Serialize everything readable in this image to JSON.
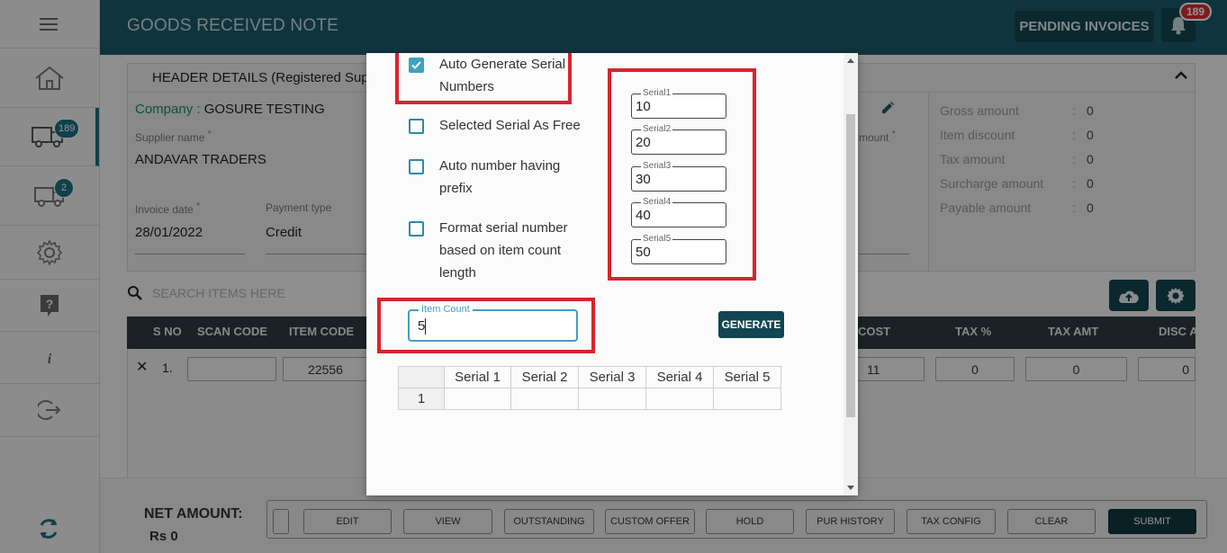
{
  "app": {
    "title": "GOODS RECEIVED NOTE",
    "pending_invoices": "PENDING INVOICES",
    "notification_count": "189"
  },
  "sidebar": {
    "items": [
      {
        "icon": "menu-icon"
      },
      {
        "icon": "home-icon"
      },
      {
        "icon": "truck-icon",
        "badge": "189"
      },
      {
        "icon": "truck-outline-icon",
        "badge": "2"
      },
      {
        "icon": "gear-icon"
      },
      {
        "icon": "help-icon"
      },
      {
        "icon": "info-icon"
      },
      {
        "icon": "logout-icon"
      },
      {
        "icon": "sync-icon"
      }
    ]
  },
  "header": {
    "title": "HEADER DETAILS (Registered Suppl",
    "company_label": "Company :",
    "company_value": "GOSURE TESTING",
    "supplier_label": "Supplier name",
    "supplier_value": "ANDAVAR TRADERS",
    "invoice_date_label": "Invoice date",
    "invoice_date_value": "28/01/2022",
    "payment_type_label": "Payment type",
    "payment_type_value": "Credit",
    "amount_label_fragment": "mount",
    "required_mark": "*"
  },
  "summary": [
    {
      "label": "Gross amount",
      "value": "0"
    },
    {
      "label": "Item discount",
      "value": "0"
    },
    {
      "label": "Tax amount",
      "value": "0"
    },
    {
      "label": "Surcharge amount",
      "value": "0"
    },
    {
      "label": "Payable amount",
      "value": "0"
    }
  ],
  "summary_sep": ":",
  "search": {
    "placeholder": "SEARCH ITEMS HERE"
  },
  "table": {
    "headers": {
      "sno": "S NO",
      "scan": "SCAN CODE",
      "item": "ITEM CODE",
      "cost": "COST",
      "taxp": "TAX %",
      "taxamt": "TAX AMT",
      "disc": "DISC A"
    },
    "row": {
      "close": "✕",
      "sno": "1.",
      "scan": "",
      "item": "22556",
      "cost": "11",
      "taxp": "0",
      "taxamt": "0",
      "disc": "0"
    }
  },
  "footer": {
    "net_label": "NET AMOUNT:",
    "net_value": "Rs 0",
    "buttons": {
      "edit": "EDIT",
      "view": "VIEW",
      "outstanding": "OUTSTANDING",
      "custom_offer": "CUSTOM OFFER",
      "hold": "HOLD",
      "pur_history": "PUR HISTORY",
      "tax_config": "TAX CONFIG",
      "clear": "CLEAR",
      "submit": "SUBMIT"
    }
  },
  "modal": {
    "options": [
      {
        "label": "Auto Generate Serial Numbers",
        "checked": true
      },
      {
        "label": "Selected Serial As Free",
        "checked": false
      },
      {
        "label": "Auto number having prefix",
        "checked": false
      },
      {
        "label": "Format serial number based on item count length",
        "checked": false
      }
    ],
    "serials": [
      {
        "label": "Serial1",
        "value": "10"
      },
      {
        "label": "Serial2",
        "value": "20"
      },
      {
        "label": "Serial3",
        "value": "30"
      },
      {
        "label": "Serial4",
        "value": "40"
      },
      {
        "label": "Serial5",
        "value": "50"
      }
    ],
    "item_count": {
      "label": "Item Count",
      "value": "5"
    },
    "generate": "GENERATE",
    "grid": {
      "headers": [
        "Serial 1",
        "Serial 2",
        "Serial 3",
        "Serial 4",
        "Serial 5"
      ],
      "row_no": "1"
    }
  },
  "colors": {
    "primary": "#1d5b6b",
    "dark_button": "#134552",
    "highlight": "#d9232e",
    "accent": "#3ea2bd",
    "badge_red": "#d42f2f"
  }
}
